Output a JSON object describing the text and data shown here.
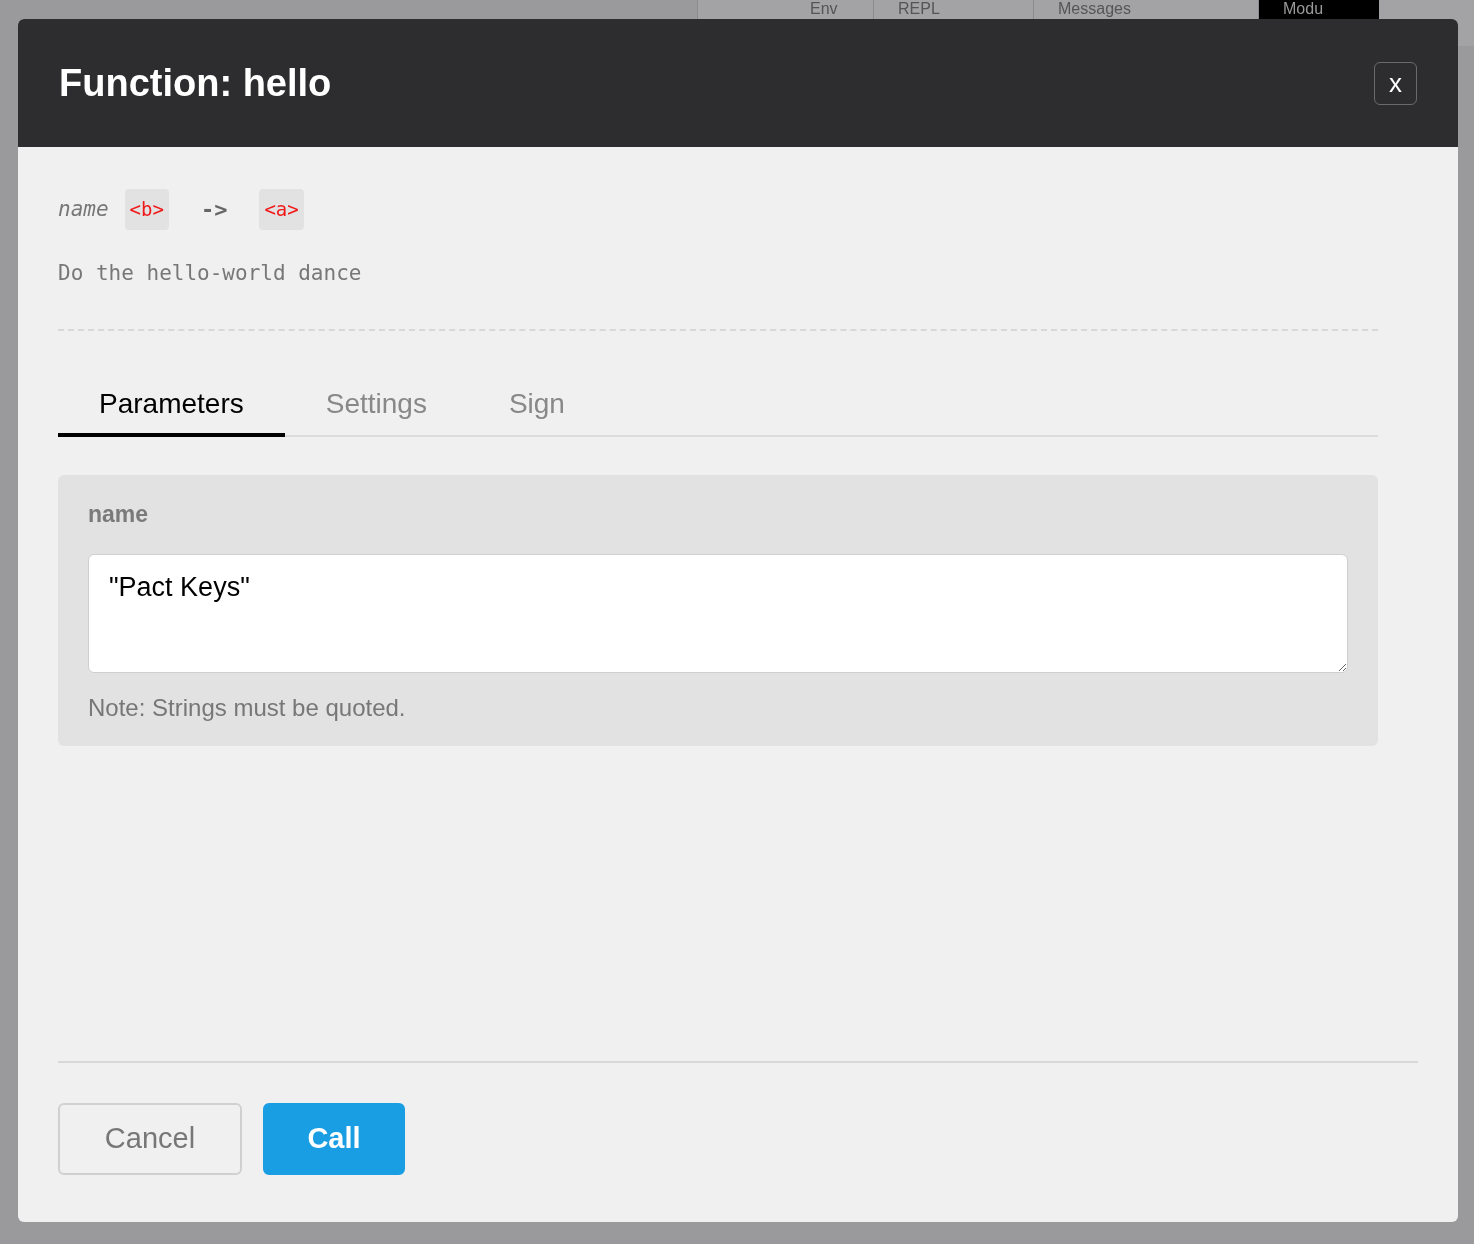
{
  "background": {
    "tabs": [
      {
        "label": "Env",
        "selected": false
      },
      {
        "label": "REPL",
        "selected": false
      },
      {
        "label": "Messages",
        "selected": false
      },
      {
        "label": "Modu",
        "selected": true
      }
    ]
  },
  "dialog": {
    "title_prefix": "Function:",
    "title_name": "hello",
    "close": "x",
    "signature": {
      "param": "name",
      "param_type": "<b>",
      "arrow": "->",
      "return_type": "<a>"
    },
    "doc": "Do the hello-world dance",
    "tabs": [
      {
        "label": "Parameters",
        "selected": true
      },
      {
        "label": "Settings",
        "selected": false
      },
      {
        "label": "Sign",
        "selected": false
      }
    ],
    "fields": [
      {
        "label": "name",
        "value": "\"Pact Keys\"",
        "note": "Note: Strings must be quoted."
      }
    ],
    "buttons": [
      {
        "label": "Cancel",
        "kind": "secondary"
      },
      {
        "label": "Call",
        "kind": "primary"
      }
    ]
  }
}
